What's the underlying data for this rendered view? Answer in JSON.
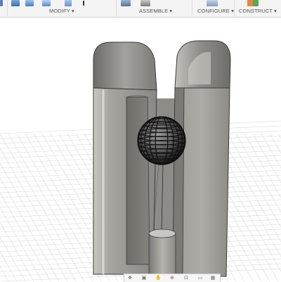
{
  "toolbar": {
    "groups": [
      {
        "label": "MODIFY",
        "arrow": "▾"
      },
      {
        "label": "ASSEMBLE",
        "arrow": "▾"
      },
      {
        "label": "CONFIGURE",
        "arrow": "▾"
      },
      {
        "label": "CONSTRUCT",
        "arrow": "▾"
      }
    ],
    "icons": {
      "modify": [
        "press-pull-icon",
        "fillet-icon",
        "chamfer-icon",
        "shell-icon",
        "move-icon"
      ],
      "assemble": [
        "new-component-icon",
        "joint-icon"
      ],
      "configure": [
        "configure-icon"
      ],
      "construct": [
        "offset-plane-icon"
      ]
    }
  },
  "viewport": {
    "background": "#ffffff",
    "grid_color": "#d9d9d9",
    "model_color": "#8d8b86",
    "model": "clevis-with-lattice-sphere"
  },
  "navbar": {
    "tools": [
      "orbit-icon",
      "pan-icon",
      "look-at-icon",
      "zoom-icon",
      "zoom-window-icon",
      "display-settings-icon",
      "grid-icon"
    ]
  }
}
